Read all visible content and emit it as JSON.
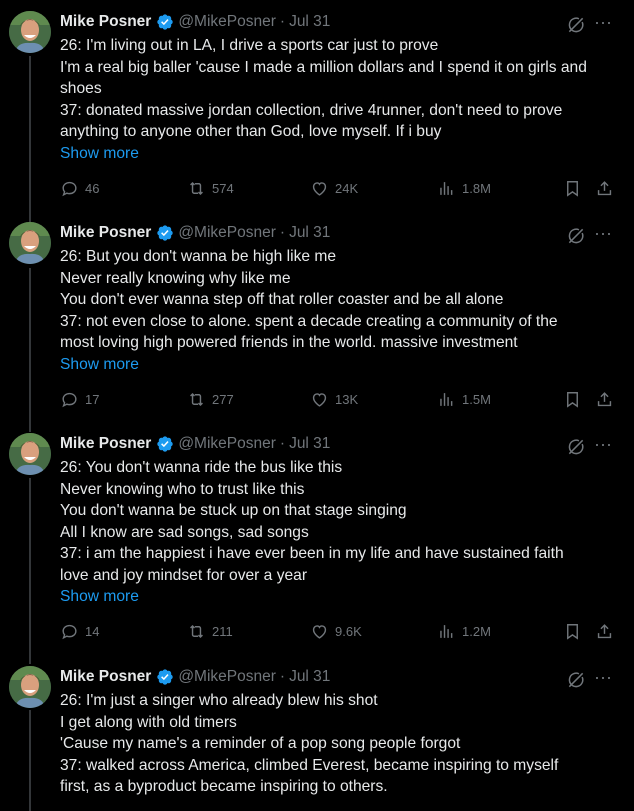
{
  "tweets": [
    {
      "name": "Mike Posner",
      "handle": "@MikePosner",
      "dot": "·",
      "date": "Jul 31",
      "lines": [
        "26: I'm living out in LA, I drive a sports car just to prove",
        "I'm a real big baller 'cause I made a million dollars and I spend it on girls and",
        "shoes",
        "37: donated massive jordan collection, drive 4runner, don't need to prove",
        "anything to anyone other than God, love myself. If i buy"
      ],
      "show_more": "Show more",
      "replies": "46",
      "reposts": "574",
      "likes": "24K",
      "views": "1.8M"
    },
    {
      "name": "Mike Posner",
      "handle": "@MikePosner",
      "dot": "·",
      "date": "Jul 31",
      "lines": [
        "26: But you don't wanna be high like me",
        "Never really knowing why like me",
        "You don't ever wanna step off that roller coaster and be all alone",
        "37: not even close to alone. spent a decade creating a community of the",
        "most loving high powered friends in the world. massive investment"
      ],
      "show_more": "Show more",
      "replies": "17",
      "reposts": "277",
      "likes": "13K",
      "views": "1.5M"
    },
    {
      "name": "Mike Posner",
      "handle": "@MikePosner",
      "dot": "·",
      "date": "Jul 31",
      "lines": [
        "26: You don't wanna ride the bus like this",
        "Never knowing who to trust like this",
        "You don't wanna be stuck up on that stage singing",
        "All I know are sad songs, sad songs",
        "37: i am the happiest i have ever been in my life and have sustained faith",
        "love and joy mindset for over a year"
      ],
      "show_more": "Show more",
      "replies": "14",
      "reposts": "211",
      "likes": "9.6K",
      "views": "1.2M"
    },
    {
      "name": "Mike Posner",
      "handle": "@MikePosner",
      "dot": "·",
      "date": "Jul 31",
      "lines": [
        "26: I'm just a singer who already blew his shot",
        "I get along with old timers",
        "'Cause my name's a reminder of a pop song people forgot",
        "37: walked across America, climbed Everest, became inspiring to myself",
        "first, as a byproduct became inspiring to others."
      ]
    }
  ],
  "icons": {
    "verified": "verified-badge-icon",
    "grok": "grok-icon",
    "more": "more-icon",
    "reply": "reply-icon",
    "repost": "repost-icon",
    "like": "like-icon",
    "views": "views-icon",
    "bookmark": "bookmark-icon",
    "share": "share-icon"
  },
  "colors": {
    "background": "#000000",
    "text": "#e7e9ea",
    "secondary": "#71767b",
    "accent": "#1d9bf0",
    "thread_line": "#333639"
  }
}
